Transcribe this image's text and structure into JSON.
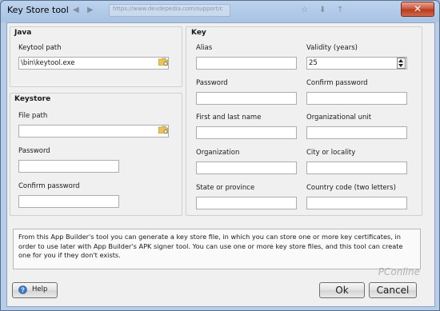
{
  "window": {
    "title": "Key Store tool",
    "close_symbol": "✕"
  },
  "ghost": {
    "url": "https://www.devdepedia.com/support/c"
  },
  "java": {
    "heading": "Java",
    "keytool_path_label": "Keytool path",
    "keytool_path_value": "\\bin\\keytool.exe"
  },
  "keystore": {
    "heading": "Keystore",
    "file_path_label": "File path",
    "file_path_value": "",
    "password_label": "Password",
    "confirm_password_label": "Confirm password"
  },
  "key": {
    "heading": "Key",
    "alias_label": "Alias",
    "validity_label": "Validity (years)",
    "validity_value": "25",
    "password_label": "Password",
    "confirm_password_label": "Confirm password",
    "first_last_name_label": "First and last name",
    "org_unit_label": "Organizational unit",
    "organization_label": "Organization",
    "city_label": "City or locality",
    "state_label": "State or province",
    "country_label": "Country code (two letters)"
  },
  "info_text": "From this App Builder's tool you can generate a key store file, in which you can store one or more key certificates, in order to use later with App Builder's APK signer tool. You can use one or more key store files, and this tool can create one for you if they don't exists.",
  "buttons": {
    "help": "Help",
    "ok": "Ok",
    "cancel": "Cancel"
  },
  "watermark": "PConline"
}
